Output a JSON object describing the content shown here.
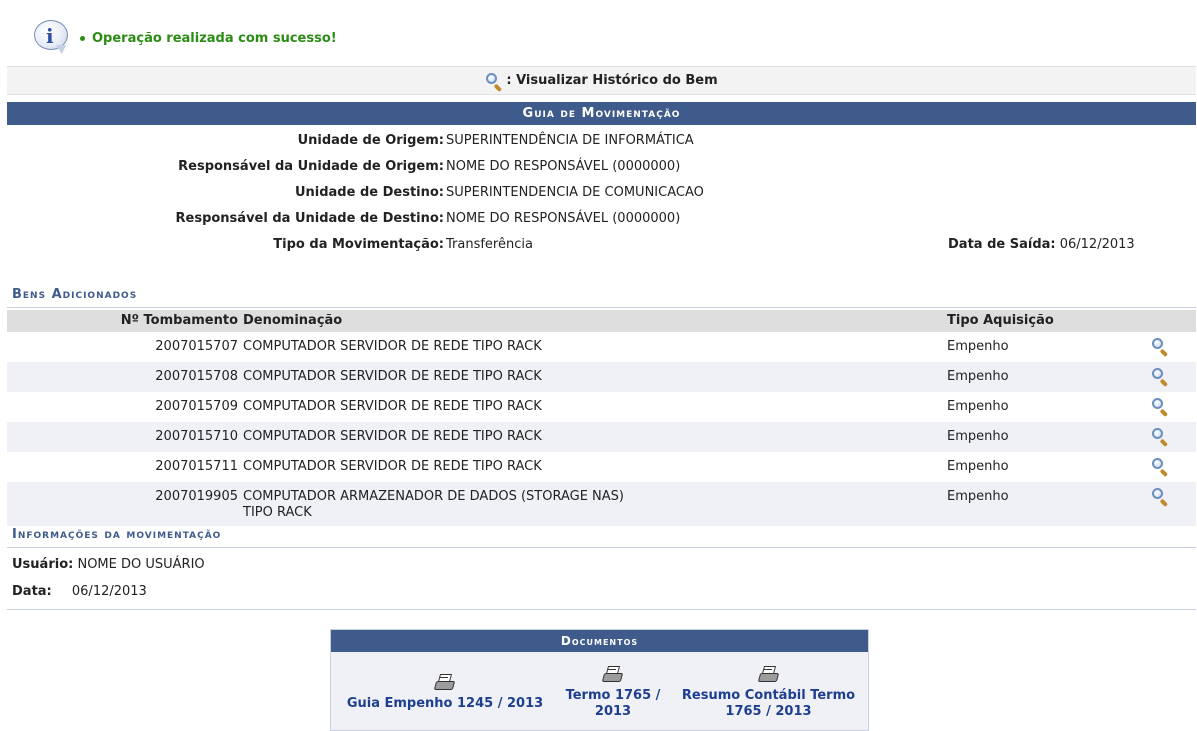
{
  "message": {
    "text": "Operação realizada com sucesso!"
  },
  "legend": {
    "label": ": Visualizar Histórico do Bem"
  },
  "guia": {
    "title": "Guia de Movimentação",
    "fields": [
      {
        "label": "Unidade de Origem:",
        "value": "SUPERINTENDÊNCIA DE INFORMÁTICA"
      },
      {
        "label": "Responsável da Unidade de Origem:",
        "value": "NOME DO RESPONSÁVEL (0000000)"
      },
      {
        "label": "Unidade de Destino:",
        "value": "SUPERINTENDENCIA DE COMUNICACAO"
      },
      {
        "label": "Responsável da Unidade de Destino:",
        "value": "NOME DO RESPONSÁVEL (0000000)"
      },
      {
        "label": "Tipo da Movimentação:",
        "value": "Transferência"
      }
    ],
    "data_saida_label": "Data de Saída:",
    "data_saida_value": "06/12/2013"
  },
  "bens": {
    "title": "Bens Adicionados",
    "columns": {
      "tombamento": "Nº Tombamento",
      "denominacao": "Denominação",
      "tipo": "Tipo Aquisição"
    },
    "rows": [
      {
        "tombamento": "2007015707",
        "denominacao": "COMPUTADOR SERVIDOR DE REDE TIPO RACK",
        "tipo": "Empenho"
      },
      {
        "tombamento": "2007015708",
        "denominacao": "COMPUTADOR SERVIDOR DE REDE TIPO RACK",
        "tipo": "Empenho"
      },
      {
        "tombamento": "2007015709",
        "denominacao": "COMPUTADOR SERVIDOR DE REDE TIPO RACK",
        "tipo": "Empenho"
      },
      {
        "tombamento": "2007015710",
        "denominacao": "COMPUTADOR SERVIDOR DE REDE TIPO RACK",
        "tipo": "Empenho"
      },
      {
        "tombamento": "2007015711",
        "denominacao": "COMPUTADOR SERVIDOR DE REDE TIPO RACK",
        "tipo": "Empenho"
      },
      {
        "tombamento": "2007019905",
        "denominacao": "COMPUTADOR ARMAZENADOR DE DADOS (STORAGE NAS) TIPO RACK",
        "tipo": "Empenho"
      }
    ]
  },
  "movimentacao": {
    "title": "Informações da movimentação",
    "usuario_label": "Usuário:",
    "usuario_value": "NOME DO USUÁRIO",
    "data_label": "Data:",
    "data_value": "06/12/2013"
  },
  "documentos": {
    "title": "Documentos",
    "links": [
      {
        "label": "Guia Empenho 1245 / 2013",
        "icon": "printer-icon"
      },
      {
        "label": "Termo 1765 / 2013",
        "icon": "printer-icon"
      },
      {
        "label": "Resumo Contábil Termo 1765 / 2013",
        "icon": "printer-icon"
      }
    ]
  },
  "colors": {
    "header_bar": "#3f5b8c",
    "success": "#2b8c14",
    "link": "#1e3f8f",
    "row_alt": "#eff1f6"
  }
}
